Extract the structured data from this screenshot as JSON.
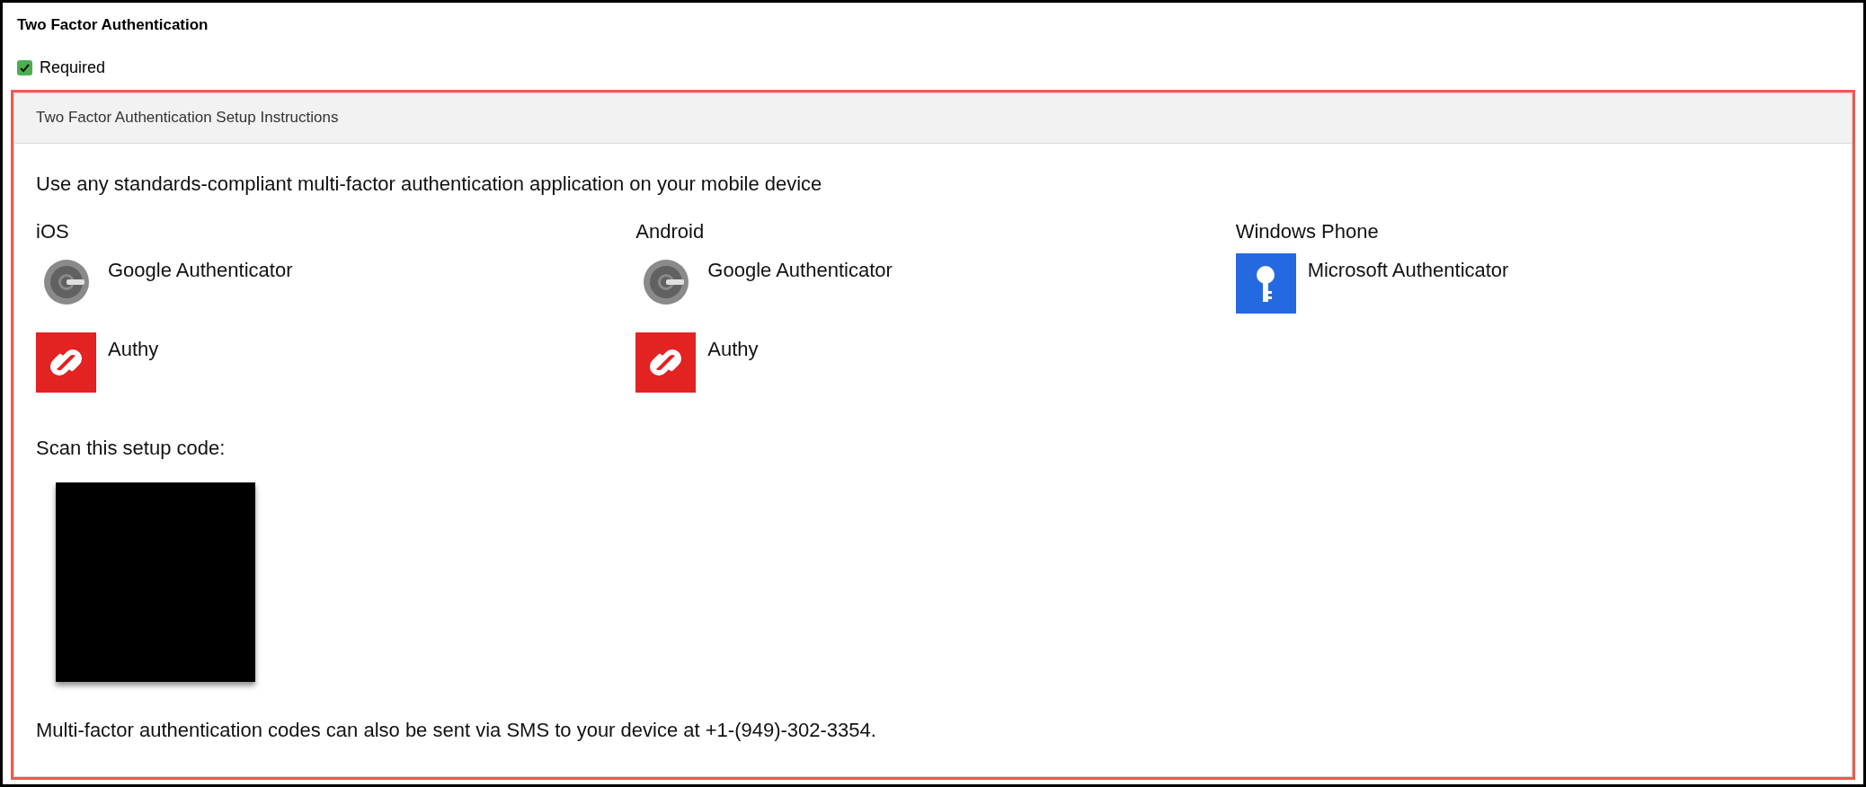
{
  "section_title": "Two Factor Authentication",
  "required": {
    "label": "Required",
    "checked": true
  },
  "panel": {
    "title": "Two Factor Authentication Setup Instructions",
    "intro": "Use any standards-compliant multi-factor authentication application on your mobile device",
    "platforms": [
      {
        "name": "iOS",
        "apps": [
          {
            "name": "Google Authenticator",
            "kind": "google"
          },
          {
            "name": "Authy",
            "kind": "authy"
          }
        ]
      },
      {
        "name": "Android",
        "apps": [
          {
            "name": "Google Authenticator",
            "kind": "google"
          },
          {
            "name": "Authy",
            "kind": "authy"
          }
        ]
      },
      {
        "name": "Windows Phone",
        "apps": [
          {
            "name": "Microsoft Authenticator",
            "kind": "microsoft"
          }
        ]
      }
    ],
    "scan_label": "Scan this setup code:",
    "sms_note": "Multi-factor authentication codes can also be sent via SMS to your device at +1-(949)-302-3354."
  }
}
